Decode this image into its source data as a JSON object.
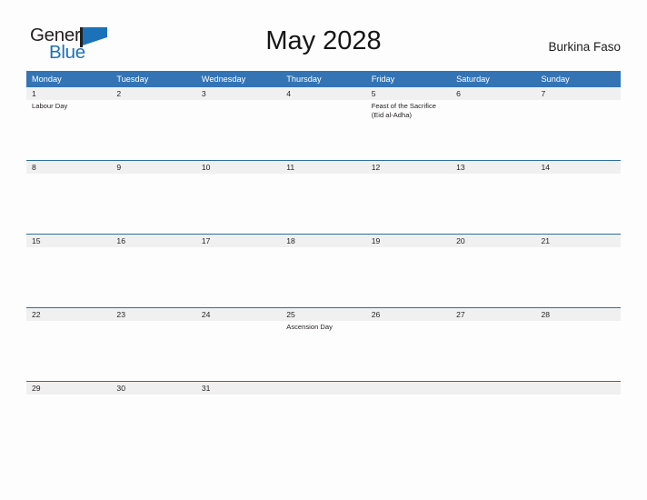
{
  "brand": {
    "name_part1": "General",
    "name_part2": "Blue",
    "flag_icon": "flag-triangle-icon",
    "color_dark": "#231f20",
    "color_blue": "#1b72b8"
  },
  "header": {
    "title": "May 2028",
    "country": "Burkina Faso"
  },
  "theme": {
    "header_blue": "#3474b4",
    "row_line_blue": "#2e6da4",
    "date_band_gray": "#f0f0f0",
    "page_background": "#fdfdfd",
    "text_dark": "#231f20"
  },
  "calendar": {
    "month": "May",
    "year": "2028",
    "weekday_headers": [
      "Monday",
      "Tuesday",
      "Wednesday",
      "Thursday",
      "Friday",
      "Saturday",
      "Sunday"
    ],
    "weeks": [
      {
        "days": [
          {
            "date": "1",
            "events": [
              "Labour Day"
            ]
          },
          {
            "date": "2",
            "events": []
          },
          {
            "date": "3",
            "events": []
          },
          {
            "date": "4",
            "events": []
          },
          {
            "date": "5",
            "events": [
              "Feast of the Sacrifice (Eid al-Adha)"
            ]
          },
          {
            "date": "6",
            "events": []
          },
          {
            "date": "7",
            "events": []
          }
        ]
      },
      {
        "days": [
          {
            "date": "8",
            "events": []
          },
          {
            "date": "9",
            "events": []
          },
          {
            "date": "10",
            "events": []
          },
          {
            "date": "11",
            "events": []
          },
          {
            "date": "12",
            "events": []
          },
          {
            "date": "13",
            "events": []
          },
          {
            "date": "14",
            "events": []
          }
        ]
      },
      {
        "days": [
          {
            "date": "15",
            "events": []
          },
          {
            "date": "16",
            "events": []
          },
          {
            "date": "17",
            "events": []
          },
          {
            "date": "18",
            "events": []
          },
          {
            "date": "19",
            "events": []
          },
          {
            "date": "20",
            "events": []
          },
          {
            "date": "21",
            "events": []
          }
        ]
      },
      {
        "days": [
          {
            "date": "22",
            "events": []
          },
          {
            "date": "23",
            "events": []
          },
          {
            "date": "24",
            "events": []
          },
          {
            "date": "25",
            "events": [
              "Ascension Day"
            ]
          },
          {
            "date": "26",
            "events": []
          },
          {
            "date": "27",
            "events": []
          },
          {
            "date": "28",
            "events": []
          }
        ]
      },
      {
        "short": true,
        "days": [
          {
            "date": "29",
            "events": []
          },
          {
            "date": "30",
            "events": []
          },
          {
            "date": "31",
            "events": []
          },
          {
            "date": "",
            "events": []
          },
          {
            "date": "",
            "events": []
          },
          {
            "date": "",
            "events": []
          },
          {
            "date": "",
            "events": []
          }
        ]
      }
    ]
  }
}
